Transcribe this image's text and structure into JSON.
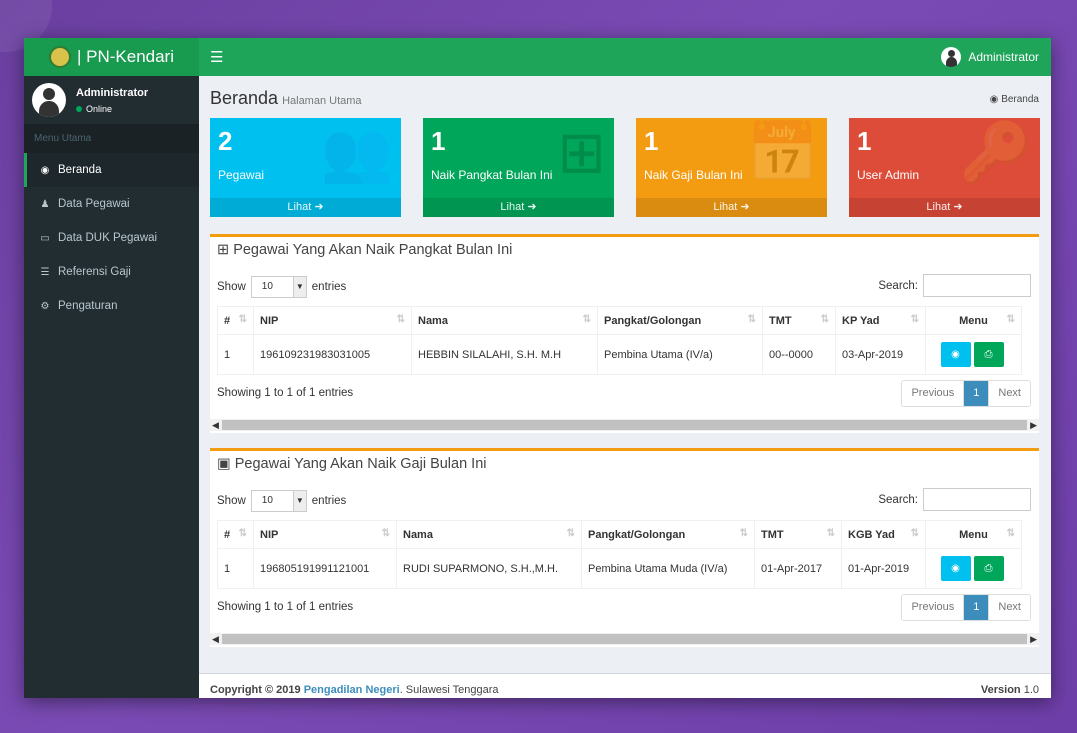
{
  "app": {
    "title": "| PN-Kendari",
    "user": "Administrator"
  },
  "sidebar": {
    "user_name": "Administrator",
    "status": "Online",
    "header": "Menu Utama",
    "items": [
      {
        "label": "Beranda",
        "icon": "dashboard-icon",
        "glyph": "◉",
        "active": true
      },
      {
        "label": "Data Pegawai",
        "icon": "user-icon",
        "glyph": "♟",
        "active": false
      },
      {
        "label": "Data DUK Pegawai",
        "icon": "credit-card-icon",
        "glyph": "▭",
        "active": false
      },
      {
        "label": "Referensi Gaji",
        "icon": "list-icon",
        "glyph": "☰",
        "active": false
      },
      {
        "label": "Pengaturan",
        "icon": "cogs-icon",
        "glyph": "⚙",
        "active": false
      }
    ]
  },
  "page": {
    "title": "Beranda",
    "subtitle": "Halaman Utama",
    "breadcrumb": "Beranda"
  },
  "boxes": [
    {
      "number": "2",
      "label": "Pegawai",
      "link": "Lihat",
      "color": "#00c0ef",
      "icon": "users-icon",
      "glyph": "👥"
    },
    {
      "number": "1",
      "label": "Naik Pangkat Bulan Ini",
      "link": "Lihat",
      "color": "#00a65a",
      "icon": "sitemap-icon",
      "glyph": "⊞"
    },
    {
      "number": "1",
      "label": "Naik Gaji Bulan Ini",
      "link": "Lihat",
      "color": "#f39c12",
      "icon": "calendar-check-icon",
      "glyph": "📅"
    },
    {
      "number": "1",
      "label": "User Admin",
      "link": "Lihat",
      "color": "#dd4b39",
      "icon": "key-icon",
      "glyph": "🔑"
    }
  ],
  "panels": [
    {
      "title": "Pegawai Yang Akan Naik Pangkat Bulan Ini",
      "icon": "sitemap-icon",
      "show": "Show",
      "entries_value": "10",
      "entries": "entries",
      "search": "Search:",
      "columns": [
        "#",
        "NIP",
        "Nama",
        "Pangkat/Golongan",
        "TMT",
        "KP Yad",
        "Menu"
      ],
      "rows": [
        [
          "1",
          "196109231983031005",
          "HEBBIN SILALAHI, S.H. M.H",
          "Pembina Utama (IV/a)",
          "00--0000",
          "03-Apr-2019"
        ]
      ],
      "info": "Showing 1 to 1 of 1 entries",
      "prev": "Previous",
      "page": "1",
      "next": "Next"
    },
    {
      "title": "Pegawai Yang Akan Naik Gaji Bulan Ini",
      "icon": "calendar-check-icon",
      "show": "Show",
      "entries_value": "10",
      "entries": "entries",
      "search": "Search:",
      "columns": [
        "#",
        "NIP",
        "Nama",
        "Pangkat/Golongan",
        "TMT",
        "KGB Yad",
        "Menu"
      ],
      "rows": [
        [
          "1",
          "196805191991121001",
          "RUDI SUPARMONO, S.H.,M.H.",
          "Pembina Utama Muda (IV/a)",
          "01-Apr-2017",
          "01-Apr-2019"
        ]
      ],
      "info": "Showing 1 to 1 of 1 entries",
      "prev": "Previous",
      "page": "1",
      "next": "Next"
    }
  ],
  "footer": {
    "copyright": "Copyright © 2019",
    "org": "Pengadilan Negeri",
    "region": ". Sulawesi Tenggara",
    "version_label": "Version",
    "version": "1.0"
  }
}
